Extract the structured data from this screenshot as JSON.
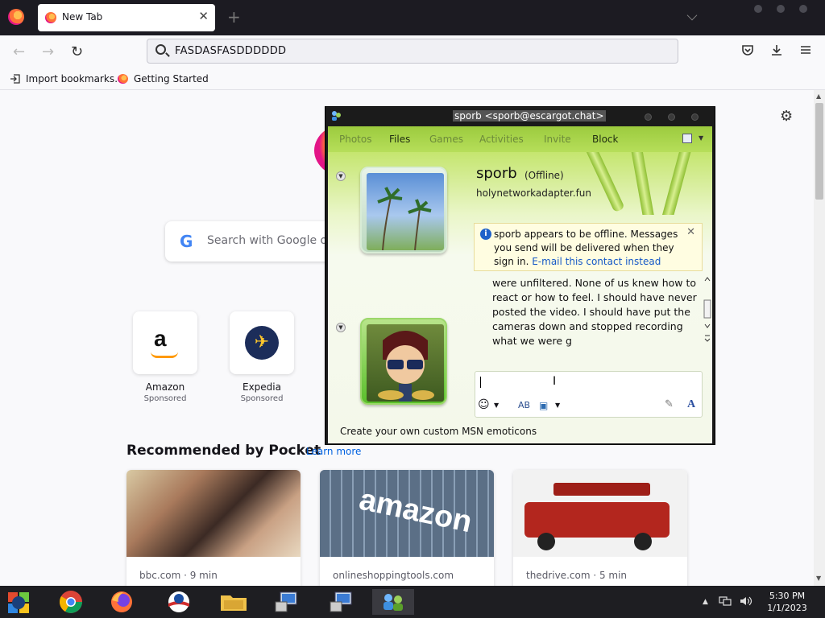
{
  "browser": {
    "tab_title": "New Tab",
    "tab_close": "✕",
    "new_tab": "+",
    "url": "FASDASFASDDDDDD",
    "bookmarks": [
      "Import bookmarks…",
      "Getting Started"
    ]
  },
  "newtab": {
    "search_placeholder": "Search with Google or",
    "google_letter": "G",
    "tiles": [
      {
        "name": "Amazon",
        "sponsor": "Sponsored"
      },
      {
        "name": "Expedia",
        "sponsor": "Sponsored"
      }
    ],
    "pocket_heading": "Recommended by Pocket",
    "pocket_link": "Learn more",
    "cards": [
      {
        "source": "bbc.com · 9 min"
      },
      {
        "source": "onlineshoppingtools.com"
      },
      {
        "source": "thedrive.com · 5 min"
      }
    ],
    "amazon_card_text": "amazon"
  },
  "msn": {
    "title": "sporb <sporb@escargot.chat>",
    "menu": [
      {
        "label": "Photos",
        "enabled": false
      },
      {
        "label": "Files",
        "enabled": true
      },
      {
        "label": "Games",
        "enabled": false
      },
      {
        "label": "Activities",
        "enabled": false
      },
      {
        "label": "Invite",
        "enabled": false
      },
      {
        "label": "Block",
        "enabled": true
      }
    ],
    "contact_name": "sporb",
    "contact_status": "(Offline)",
    "contact_message": "holynetworkadapter.fun",
    "info_text": "sporb appears to be offline. Messages you send will be delivered when they sign in.",
    "info_link": "E-mail this contact instead",
    "conversation": "were unfiltered. None of us knew how to react or how to feel. I should have never posted the video. I should have put the cameras down and stopped recording what we were g",
    "bottom_link": "Create your own custom MSN emoticons"
  },
  "taskbar": {
    "time": "5:30 PM",
    "date": "1/1/2023"
  },
  "colors": {
    "msn_green": "#a8d54a",
    "link_blue": "#0061e0",
    "taskbar": "#1e1e22"
  }
}
